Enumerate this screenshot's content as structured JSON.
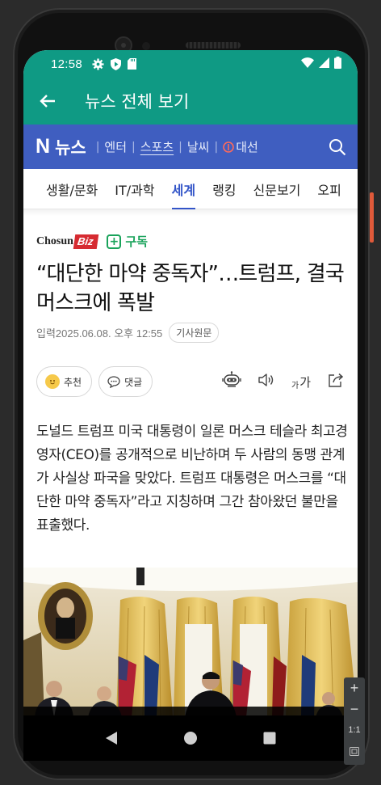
{
  "status": {
    "time": "12:58"
  },
  "appbar": {
    "title": "뉴스 전체 보기"
  },
  "navbar": {
    "logo_letter": "N",
    "logo_text": "뉴스",
    "links": [
      "엔터",
      "스포츠",
      "날씨",
      "대선"
    ]
  },
  "tabs": [
    "생활/문화",
    "IT/과학",
    "세계",
    "랭킹",
    "신문보기",
    "오피"
  ],
  "active_tab": "세계",
  "article": {
    "publisher": "Chosun",
    "publisher_suffix": "Biz",
    "subscribe_label": "구독",
    "headline": "“대단한 마약 중독자”…트럼프, 결국 머스크에 폭발",
    "date": "입력2025.06.08. 오후 12:55",
    "original_label": "기사원문",
    "recommend_label": "추천",
    "comment_label": "댓글",
    "font_size_label_small": "가",
    "font_size_label": "가",
    "body": "도널드 트럼프 미국 대통령이 일론 머스크 테슬라 최고경영자(CEO)를 공개적으로 비난하며 두 사람의 동맹 관계가 사실상 파국을 맞았다. 트럼프 대통령은 머스크를 “대단한 마약 중독자”라고 지칭하며 그간 참아왔던 불만을 표출했다."
  },
  "emulator_tools": {
    "zoom_label": "1:1"
  },
  "colors": {
    "teal": "#0f9a84",
    "nav_blue": "#3f5ec0",
    "active_tab": "#3355c8",
    "subscribe_green": "#19a35a"
  }
}
